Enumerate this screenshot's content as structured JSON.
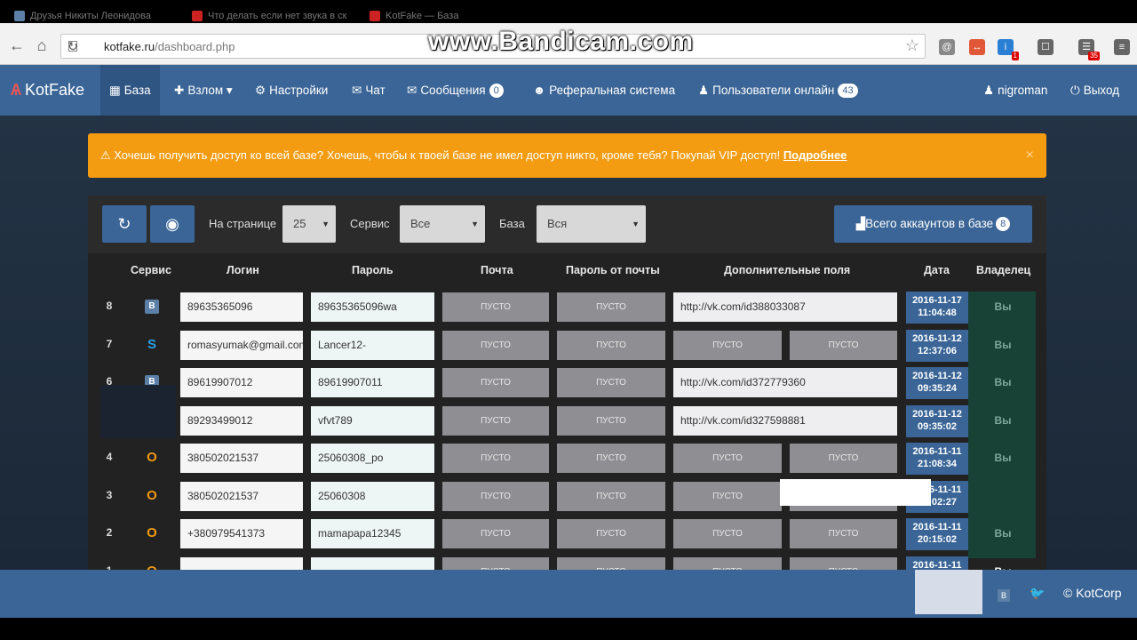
{
  "browser": {
    "tabs": [
      {
        "title": "Друзья Никиты Леонидова",
        "color": "#5b7fa6"
      },
      {
        "title": "Что делать если нет звука в ск",
        "color": "#cc2222"
      },
      {
        "title": "KotFake — База",
        "color": "#cc2222"
      }
    ],
    "url_host": "kotfake.ru",
    "url_path": "/dashboard.php",
    "watermark": "www.Bandicam.com",
    "extensions": [
      {
        "icon": "@",
        "color": "#888"
      },
      {
        "icon": "↔",
        "color": "#e15838"
      },
      {
        "icon": "i",
        "color": "#2a7fd4",
        "badge": "1"
      },
      {
        "icon": "☐",
        "color": "#666"
      },
      {
        "icon": "☰",
        "color": "#666",
        "badge": "35"
      },
      {
        "icon": "≡",
        "color": "#666"
      }
    ]
  },
  "header": {
    "brand": "KotFake",
    "nav": [
      {
        "label": "База",
        "icon": "▦",
        "active": true
      },
      {
        "label": "Взлом ▾",
        "icon": "✚"
      },
      {
        "label": "Настройки",
        "icon": "⚙"
      },
      {
        "label": "Чат",
        "icon": "✉"
      },
      {
        "label": "Сообщения",
        "icon": "✉",
        "badge": "0"
      },
      {
        "label": "Реферальная система",
        "icon": "☻"
      },
      {
        "label": "Пользователи онлайн",
        "icon": "♟",
        "badge": "43"
      }
    ],
    "user": "nigroman",
    "logout": "Выход"
  },
  "alert": {
    "text": "Хочешь получить доступ ко всей базе? Хочешь, чтобы к твоей базе не имел доступ никто, кроме тебя? Покупай VIP доступ! ",
    "link": "Подробнее",
    "close": "×"
  },
  "toolbar": {
    "per_page_label": "На странице",
    "per_page_value": "25",
    "service_label": "Сервис",
    "service_value": "Все",
    "base_label": "База",
    "base_value": "Вся",
    "total_label": "Всего аккаунтов в базе",
    "total_count": "8"
  },
  "table": {
    "headers": {
      "service": "Сервис",
      "login": "Логин",
      "password": "Пароль",
      "mail": "Почта",
      "mail_password": "Пароль от почты",
      "extra": "Дополнительные поля",
      "date": "Дата",
      "owner": "Владелец"
    },
    "empty": "ПУСТО",
    "rows": [
      {
        "num": "8",
        "service": "vk",
        "login": "89635365096",
        "password": "89635365096wa",
        "extra": "http://vk.com/id388033087",
        "date1": "2016-11-17",
        "date2": "11:04:48",
        "owner": "Вы"
      },
      {
        "num": "7",
        "service": "skype",
        "login": "romasyumak@gmail.com",
        "password": "Lancer12-",
        "extra": "",
        "date1": "2016-11-12",
        "date2": "12:37:06",
        "owner": "Вы"
      },
      {
        "num": "6",
        "service": "vk",
        "login": "89619907012",
        "password": "89619907011",
        "extra": "http://vk.com/id372779360",
        "date1": "2016-11-12",
        "date2": "09:35:24",
        "owner": "Вы"
      },
      {
        "num": "5",
        "service": "vk",
        "login": "89293499012",
        "password": "vfvt789",
        "extra": "http://vk.com/id327598881",
        "date1": "2016-11-12",
        "date2": "09:35:02",
        "owner": "Вы"
      },
      {
        "num": "4",
        "service": "ok",
        "login": "380502021537",
        "password": "25060308_po",
        "extra": "",
        "date1": "2016-11-11",
        "date2": "21:08:34",
        "owner": "Вы"
      },
      {
        "num": "3",
        "service": "ok",
        "login": "380502021537",
        "password": "25060308",
        "extra": "",
        "date1": "2016-11-11",
        "date2": "21:02:27",
        "owner": ""
      },
      {
        "num": "2",
        "service": "ok",
        "login": "+380979541373",
        "password": "mamapapa12345",
        "extra": "",
        "date1": "2016-11-11",
        "date2": "20:15:02",
        "owner": "Вы"
      },
      {
        "num": "1",
        "service": "ok",
        "login": "",
        "password": "",
        "extra": "",
        "date1": "2016-11-11",
        "date2": "",
        "owner": "Вы"
      }
    ]
  },
  "footer": {
    "copyright": "© KotCorp",
    "vk": "В",
    "twitter": "🐦"
  },
  "colors": {
    "brand_blue": "#3a6596",
    "alert_orange": "#f39c12",
    "panel_dark": "#222222"
  }
}
